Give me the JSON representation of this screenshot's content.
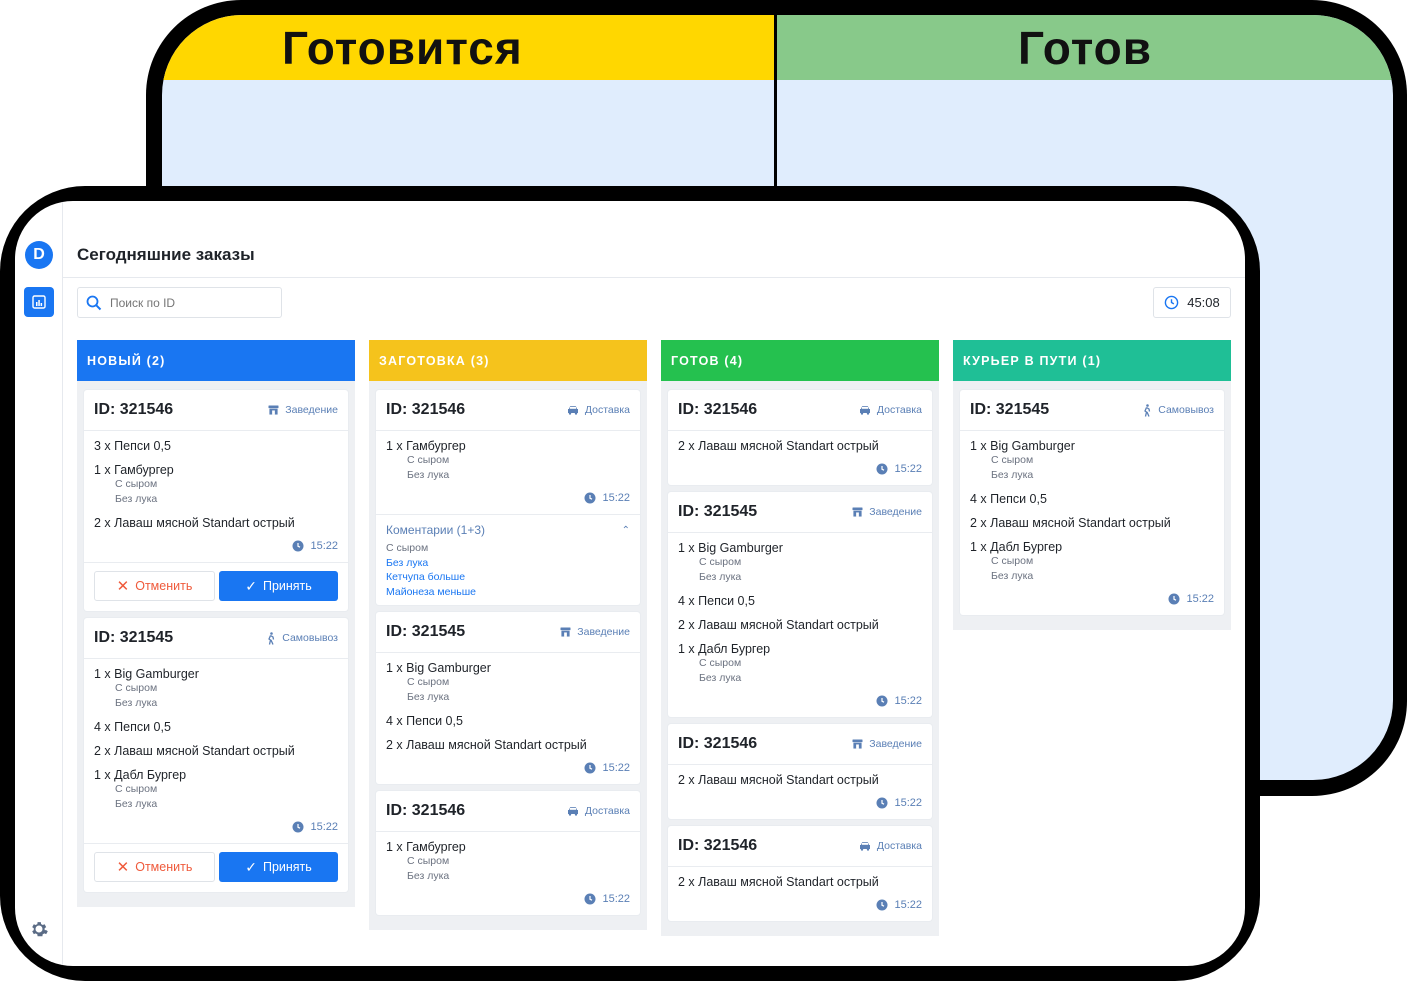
{
  "back_display": {
    "left_title": "Готовится",
    "right_title": "Готов",
    "left_color": "#ffd700",
    "right_color": "#88c98a"
  },
  "app": {
    "avatar_letter": "D",
    "page_title": "Сегодняшние заказы",
    "search_placeholder": "Поиск по ID",
    "timer": "45:08",
    "accent": "#1976f2"
  },
  "columns": [
    {
      "title": "НОВЫЙ (2)",
      "color": "#1976f2",
      "cards": [
        {
          "id": "ID: 321546",
          "type": "Заведение",
          "type_icon": "store-icon",
          "items": [
            {
              "main": "3 x Пепси 0,5",
              "options": []
            },
            {
              "main": "1 x Гамбургер",
              "options": [
                "С сыром",
                "Без лука"
              ]
            },
            {
              "main": "2 x Лаваш мясной Standart острый",
              "options": []
            }
          ],
          "time": "15:22",
          "actions": {
            "cancel": "Отменить",
            "accept": "Принять"
          }
        },
        {
          "id": "ID: 321545",
          "type": "Самовывоз",
          "type_icon": "walk-icon",
          "items": [
            {
              "main": "1 x Big Gamburger",
              "options": [
                "С сыром",
                "Без лука"
              ]
            },
            {
              "main": "4 x Пепси 0,5",
              "options": []
            },
            {
              "main": "2 x Лаваш мясной Standart острый",
              "options": []
            },
            {
              "main": "1 x Дабл Бургер",
              "options": [
                "С сыром",
                "Без лука"
              ]
            }
          ],
          "time": "15:22",
          "actions": {
            "cancel": "Отменить",
            "accept": "Принять"
          }
        }
      ]
    },
    {
      "title": "ЗАГОТОВКА (3)",
      "color": "#f5c31c",
      "cards": [
        {
          "id": "ID: 321546",
          "type": "Доставка",
          "type_icon": "car-icon",
          "items": [
            {
              "main": "1 x Гамбургер",
              "options": [
                "С сыром",
                "Без лука"
              ]
            }
          ],
          "time": "15:22",
          "comments": {
            "title": "Коментарии (1+3)",
            "lines": [
              "С сыром",
              "Без лука",
              "Кетчупа больше",
              "Майонеза меньше"
            ]
          }
        },
        {
          "id": "ID: 321545",
          "type": "Заведение",
          "type_icon": "store-icon",
          "items": [
            {
              "main": "1 x Big Gamburger",
              "options": [
                "С сыром",
                "Без лука"
              ]
            },
            {
              "main": "4 x Пепси 0,5",
              "options": []
            },
            {
              "main": "2 x Лаваш мясной Standart острый",
              "options": []
            }
          ],
          "time": "15:22"
        },
        {
          "id": "ID: 321546",
          "type": "Доставка",
          "type_icon": "car-icon",
          "items": [
            {
              "main": "1 x Гамбургер",
              "options": [
                "С сыром",
                "Без лука"
              ]
            }
          ],
          "time": "15:22"
        }
      ]
    },
    {
      "title": "ГОТОВ (4)",
      "color": "#25c14f",
      "cards": [
        {
          "id": "ID: 321546",
          "type": "Доставка",
          "type_icon": "car-icon",
          "items": [
            {
              "main": "2 x Лаваш мясной Standart острый",
              "options": []
            }
          ],
          "time": "15:22"
        },
        {
          "id": "ID: 321545",
          "type": "Заведение",
          "type_icon": "store-icon",
          "items": [
            {
              "main": "1 x Big Gamburger",
              "options": [
                "С сыром",
                "Без лука"
              ]
            },
            {
              "main": "4 x Пепси 0,5",
              "options": []
            },
            {
              "main": "2 x Лаваш мясной Standart острый",
              "options": []
            },
            {
              "main": "1 x Дабл Бургер",
              "options": [
                "С сыром",
                "Без лука"
              ]
            }
          ],
          "time": "15:22"
        },
        {
          "id": "ID: 321546",
          "type": "Заведение",
          "type_icon": "store-icon",
          "items": [
            {
              "main": "2 x Лаваш мясной Standart острый",
              "options": []
            }
          ],
          "time": "15:22"
        },
        {
          "id": "ID: 321546",
          "type": "Доставка",
          "type_icon": "car-icon",
          "items": [
            {
              "main": "2 x Лаваш мясной Standart острый",
              "options": []
            }
          ],
          "time": "15:22"
        }
      ]
    },
    {
      "title": "КУРЬЕР В ПУТИ (1)",
      "color": "#1fbf96",
      "cards": [
        {
          "id": "ID: 321545",
          "type": "Самовывоз",
          "type_icon": "walk-icon",
          "items": [
            {
              "main": "1 x Big Gamburger",
              "options": [
                "С сыром",
                "Без лука"
              ]
            },
            {
              "main": "4 x Пепси 0,5",
              "options": []
            },
            {
              "main": "2 x Лаваш мясной Standart острый",
              "options": []
            },
            {
              "main": "1 x Дабл Бургер",
              "options": [
                "С сыром",
                "Без лука"
              ]
            }
          ],
          "time": "15:22"
        }
      ]
    }
  ]
}
